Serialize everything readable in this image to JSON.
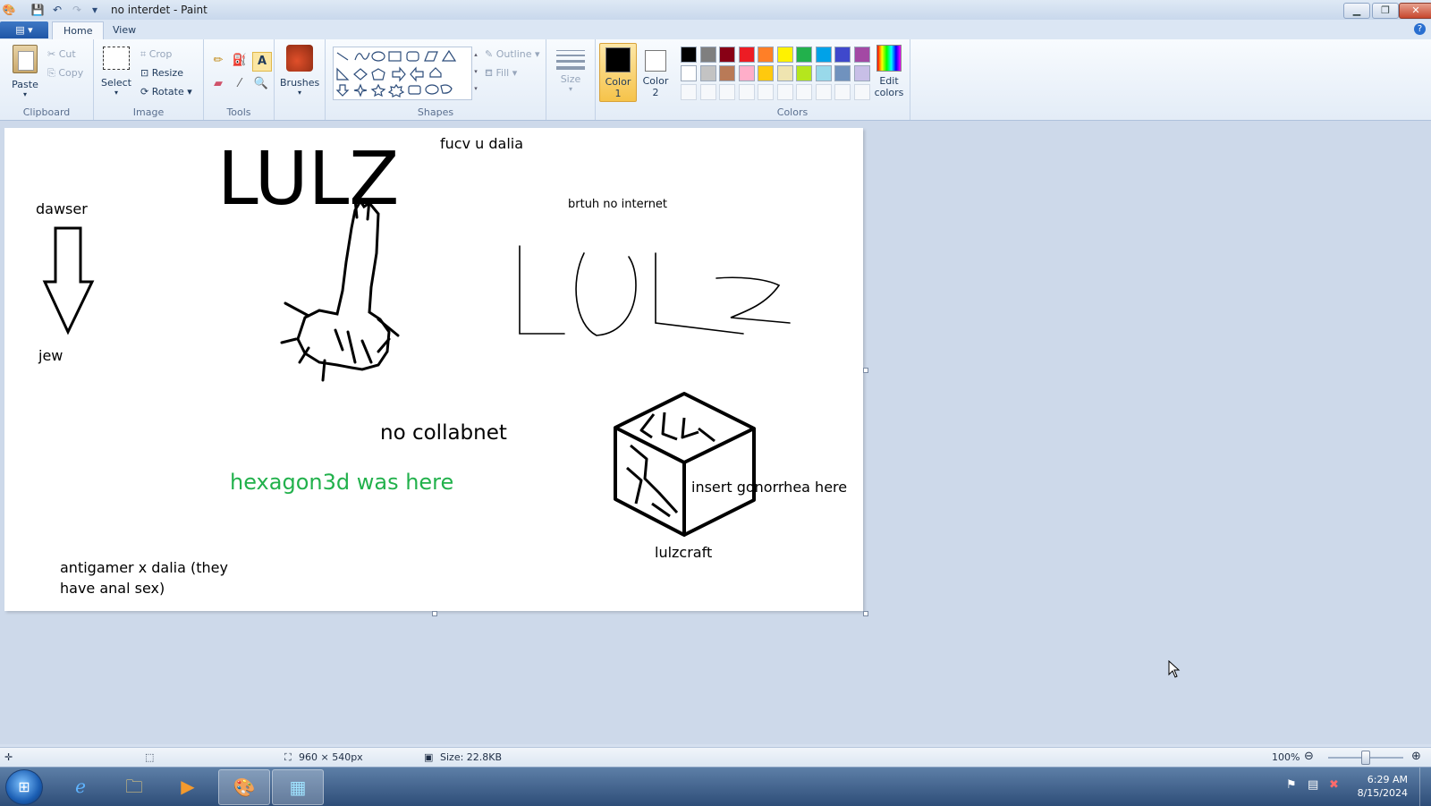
{
  "window": {
    "title": "no interdet - Paint"
  },
  "ribbon_tabs": {
    "home": "Home",
    "view": "View"
  },
  "ribbon": {
    "clipboard": {
      "paste": "Paste",
      "cut": "Cut",
      "copy": "Copy",
      "label": "Clipboard"
    },
    "image": {
      "select": "Select",
      "crop": "Crop",
      "resize": "Resize",
      "rotate": "Rotate",
      "label": "Image"
    },
    "tools": {
      "label": "Tools"
    },
    "brushes": {
      "label": "Brushes"
    },
    "shapes": {
      "outline": "Outline",
      "fill": "Fill",
      "label": "Shapes"
    },
    "size": {
      "label": "Size"
    },
    "color1": {
      "label_a": "Color",
      "label_b": "1"
    },
    "color2": {
      "label_a": "Color",
      "label_b": "2"
    },
    "colors": {
      "label": "Colors",
      "edit_a": "Edit",
      "edit_b": "colors"
    }
  },
  "palette": [
    "#000000",
    "#7f7f7f",
    "#880015",
    "#ed1c24",
    "#ff7f27",
    "#fff200",
    "#22b14c",
    "#00a2e8",
    "#3f48cc",
    "#a349a4",
    "#ffffff",
    "#c3c3c3",
    "#b97a57",
    "#ffaec9",
    "#ffc90e",
    "#efe4b0",
    "#b5e61d",
    "#99d9ea",
    "#7092be",
    "#c8bfe7"
  ],
  "canvas": {
    "lulz_big": "LULZ",
    "fucv": "fucv u  dalia",
    "dawser": "dawser",
    "jew": "jew",
    "brtuh": "brtuh no internet",
    "no_collabnet": "no collabnet",
    "hexagon": "hexagon3d was here",
    "insert": "insert gonorrhea  here",
    "lulzcraft": "lulzcraft",
    "antigamer_1": "antigamer x dalia (they",
    "antigamer_2": "have anal sex)",
    "hexagon_color": "#22b14c"
  },
  "status": {
    "dimensions": "960 × 540px",
    "size": "Size: 22.8KB",
    "zoom": "100%",
    "zoom_level": 0.5
  },
  "taskbar": {
    "time": "6:29 AM",
    "date": "8/15/2024"
  }
}
